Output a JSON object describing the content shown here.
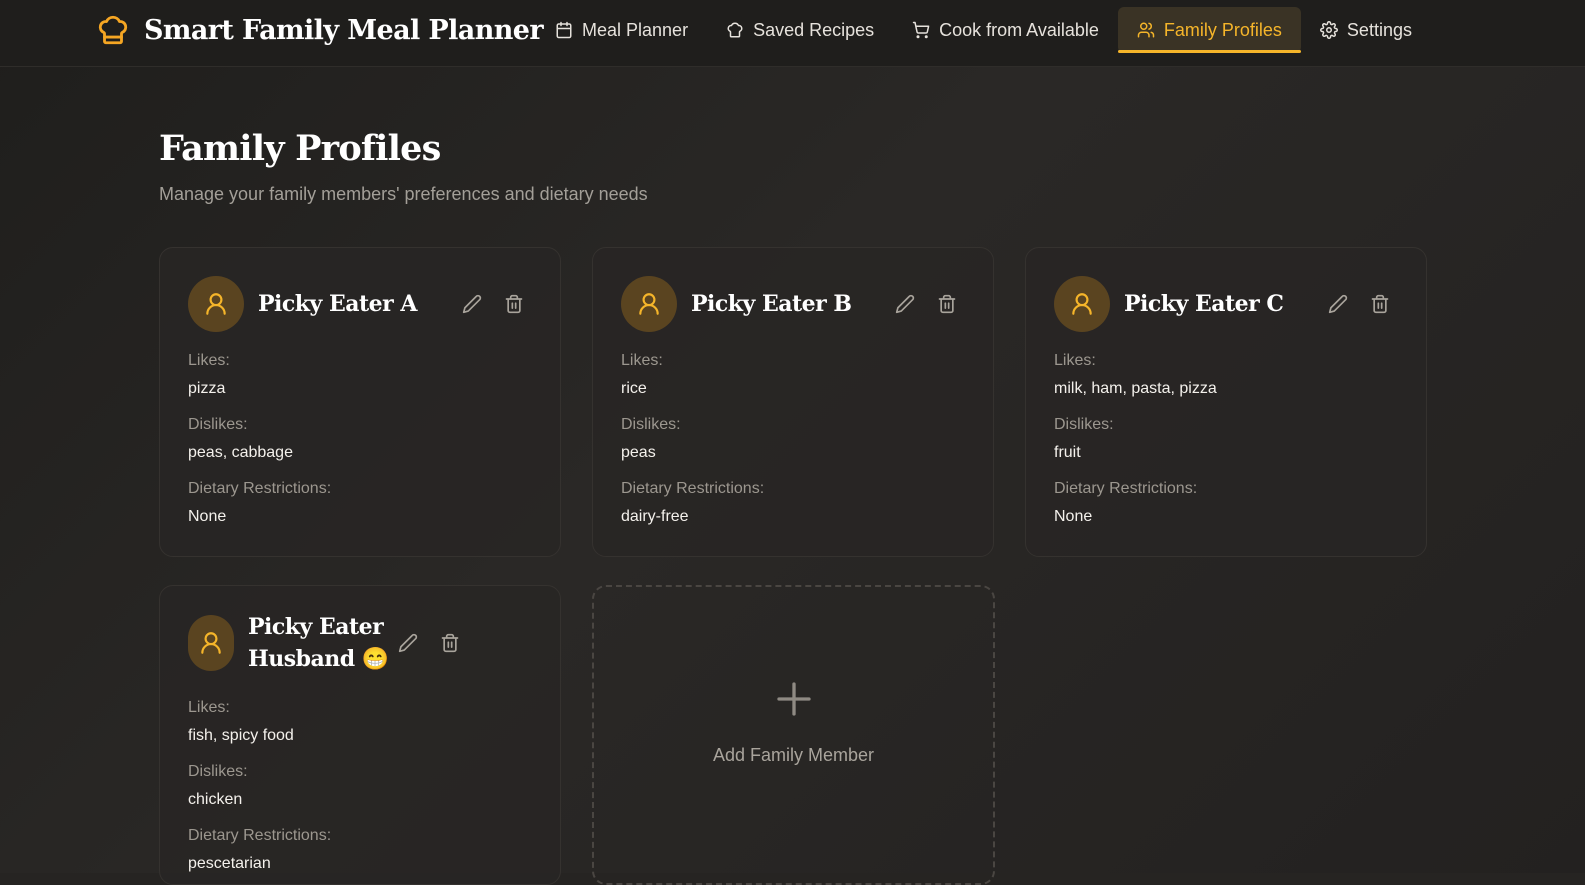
{
  "app": {
    "title": "Smart Family Meal Planner",
    "accent_color": "#f5b52a"
  },
  "nav": {
    "items": [
      {
        "label": "Meal Planner",
        "icon": "calendar-icon"
      },
      {
        "label": "Saved Recipes",
        "icon": "chef-hat-icon"
      },
      {
        "label": "Cook from Available",
        "icon": "cart-icon"
      },
      {
        "label": "Family Profiles",
        "icon": "users-icon",
        "active": true
      },
      {
        "label": "Settings",
        "icon": "gear-icon"
      }
    ]
  },
  "page": {
    "title": "Family Profiles",
    "subtitle": "Manage your family members' preferences and dietary needs"
  },
  "labels": {
    "likes": "Likes:",
    "dislikes": "Dislikes:",
    "dietary": "Dietary Restrictions:"
  },
  "members": [
    {
      "name": "Picky Eater A",
      "likes": "pizza",
      "dislikes": "peas, cabbage",
      "dietary": "None"
    },
    {
      "name": "Picky Eater B",
      "likes": "rice",
      "dislikes": "peas",
      "dietary": "dairy-free"
    },
    {
      "name": "Picky Eater C",
      "likes": "milk, ham, pasta, pizza",
      "dislikes": "fruit",
      "dietary": "None"
    },
    {
      "name": "Picky Eater Husband 😁",
      "likes": "fish, spicy food",
      "dislikes": "chicken",
      "dietary": "pescetarian"
    }
  ],
  "add_member": {
    "label": "Add Family Member"
  }
}
